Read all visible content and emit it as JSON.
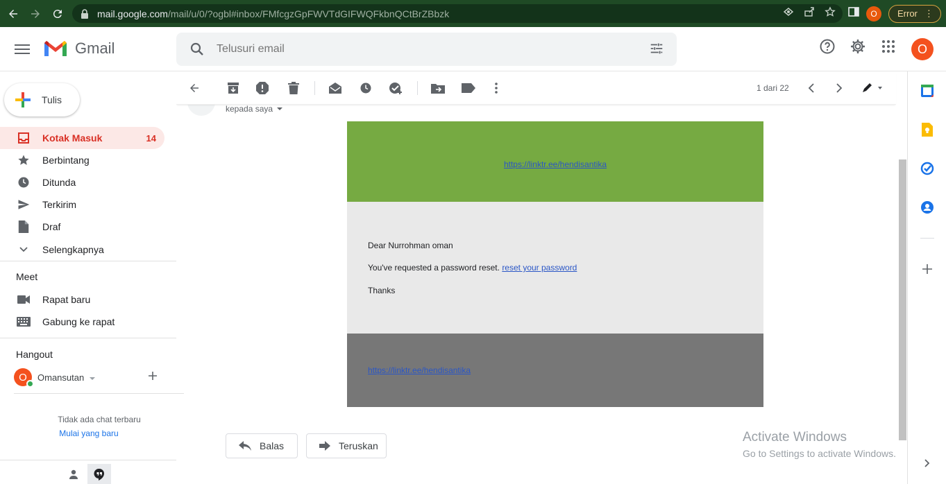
{
  "browser": {
    "url_host": "mail.google.com",
    "url_path": "/mail/u/0/?ogbl#inbox/FMfcgzGpFWVTdGIFWQFkbnQCtBrZBbzk",
    "profile_initial": "O",
    "error_label": "Error"
  },
  "header": {
    "app_name": "Gmail",
    "search_placeholder": "Telusuri email",
    "avatar_initial": "O"
  },
  "sidebar": {
    "compose_label": "Tulis",
    "items": [
      {
        "label": "Kotak Masuk",
        "count": "14"
      },
      {
        "label": "Berbintang"
      },
      {
        "label": "Ditunda"
      },
      {
        "label": "Terkirim"
      },
      {
        "label": "Draf"
      },
      {
        "label": "Selengkapnya"
      }
    ],
    "meet_title": "Meet",
    "meet_items": [
      "Rapat baru",
      "Gabung ke rapat"
    ],
    "hangout_title": "Hangout",
    "hangout_user": "Omansutan",
    "hangout_initial": "O",
    "no_chat": "Tidak ada chat terbaru",
    "start_chat": "Mulai yang baru"
  },
  "toolbar": {
    "pager": "1 dari 22"
  },
  "message": {
    "to_label": "kepada saya",
    "header_link": "https://linktr.ee/hendisantika",
    "greeting": "Dear Nurrohman oman",
    "line_text": "You've requested a password reset.",
    "reset_link": "reset your password",
    "thanks": "Thanks",
    "footer_link": "https://linktr.ee/hendisantika"
  },
  "actions": {
    "reply": "Balas",
    "forward": "Teruskan"
  },
  "watermark": {
    "title": "Activate Windows",
    "subtitle": "Go to Settings to activate Windows."
  },
  "colors": {
    "browser_frame": "#1f4a25",
    "mail_header_bg": "#76aa42",
    "mail_body_bg": "#e9e9e9",
    "mail_footer_bg": "#777777",
    "inbox_active_bg": "#fce8e6",
    "inbox_active_text": "#d93025"
  }
}
